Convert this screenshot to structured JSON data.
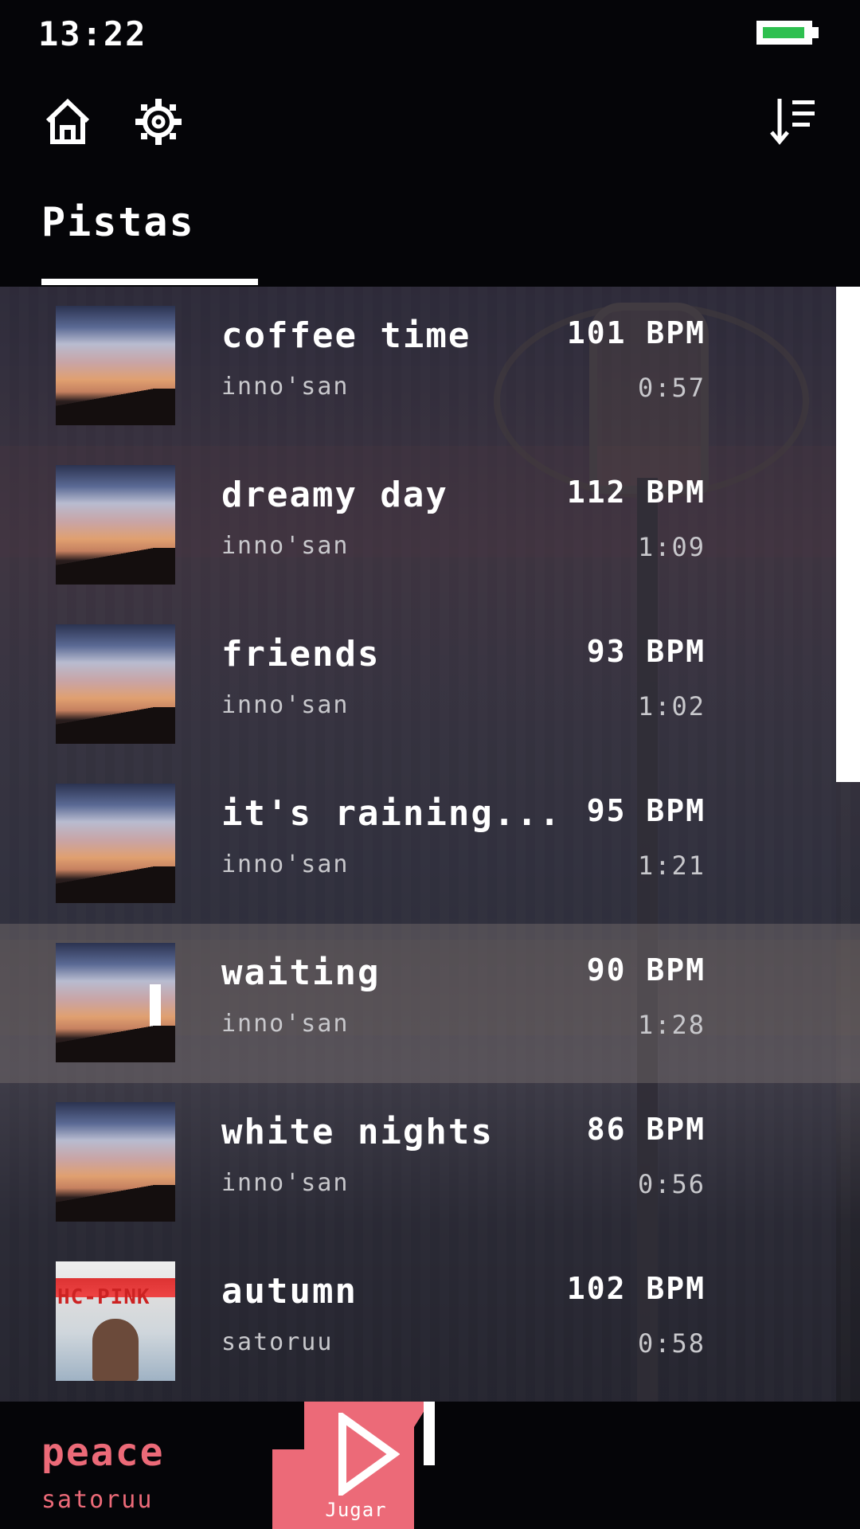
{
  "status_bar": {
    "time": "13:22"
  },
  "header": {
    "tab_label": "Pistas"
  },
  "tracks": [
    {
      "title": "coffee time",
      "artist": "inno'san",
      "bpm": "101 BPM",
      "duration": "0:57"
    },
    {
      "title": "dreamy day",
      "artist": "inno'san",
      "bpm": "112 BPM",
      "duration": "1:09"
    },
    {
      "title": "friends",
      "artist": "inno'san",
      "bpm": "93 BPM",
      "duration": "1:02"
    },
    {
      "title": "it's raining...",
      "artist": "inno'san",
      "bpm": "95 BPM",
      "duration": "1:21"
    },
    {
      "title": "waiting",
      "artist": "inno'san",
      "bpm": "90 BPM",
      "duration": "1:28"
    },
    {
      "title": "white nights",
      "artist": "inno'san",
      "bpm": "86 BPM",
      "duration": "0:56"
    },
    {
      "title": "autumn",
      "artist": "satoruu",
      "bpm": "102 BPM",
      "duration": "0:58"
    }
  ],
  "poster_text": "HC-PINK",
  "now_playing": {
    "title": "peace",
    "artist": "satoruu",
    "play_label": "Jugar"
  },
  "colors": {
    "accent": "#ec6a78",
    "battery": "#2ec04f",
    "background": "#050508"
  }
}
